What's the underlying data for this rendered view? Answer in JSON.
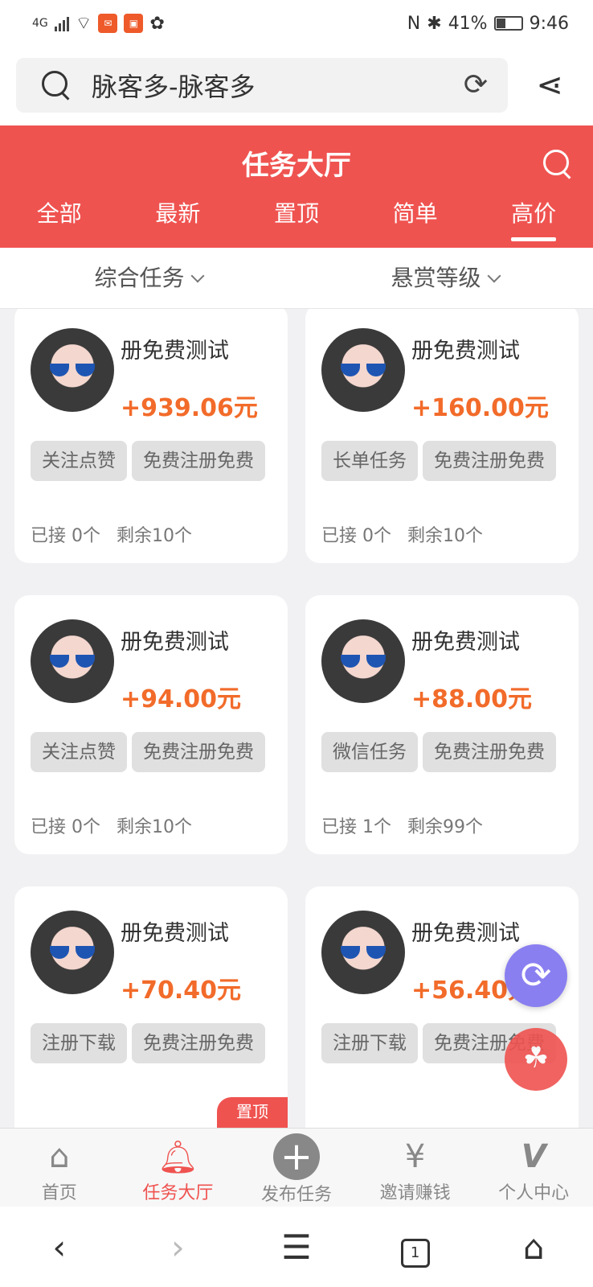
{
  "status_bar": {
    "network": "4G",
    "battery": "41%",
    "battery_level": 0.41,
    "time": "9:46"
  },
  "url_bar": {
    "text": "脉客多-脉客多"
  },
  "header": {
    "title": "任务大厅"
  },
  "tabs": [
    {
      "label": "全部",
      "active": false
    },
    {
      "label": "最新",
      "active": false
    },
    {
      "label": "置顶",
      "active": false
    },
    {
      "label": "简单",
      "active": false
    },
    {
      "label": "高价",
      "active": true
    }
  ],
  "filters": [
    {
      "label": "综合任务"
    },
    {
      "label": "悬赏等级"
    }
  ],
  "cards": [
    {
      "title": "册免费测试",
      "price": "+939.06元",
      "tags": [
        "关注点赞",
        "免费注册免费"
      ],
      "accepted": "已接 0个",
      "remaining": "剩余10个"
    },
    {
      "title": "册免费测试",
      "price": "+160.00元",
      "tags": [
        "长单任务",
        "免费注册免费"
      ],
      "accepted": "已接 0个",
      "remaining": "剩余10个"
    },
    {
      "title": "册免费测试",
      "price": "+94.00元",
      "tags": [
        "关注点赞",
        "免费注册免费"
      ],
      "accepted": "已接 0个",
      "remaining": "剩余10个"
    },
    {
      "title": "册免费测试",
      "price": "+88.00元",
      "tags": [
        "微信任务",
        "免费注册免费"
      ],
      "accepted": "已接 1个",
      "remaining": "剩余99个"
    },
    {
      "title": "册免费测试",
      "price": "+70.40元",
      "tags": [
        "注册下载",
        "免费注册免费"
      ],
      "badge": "置顶"
    },
    {
      "title": "册免费测试",
      "price": "+56.40元",
      "tags": [
        "注册下载",
        "免费注册免费"
      ]
    }
  ],
  "bottom_nav": [
    {
      "label": "首页",
      "icon": "home-icon",
      "active": false
    },
    {
      "label": "任务大厅",
      "icon": "bell-icon",
      "active": true
    },
    {
      "label": "发布任务",
      "icon": "plus-icon",
      "active": false
    },
    {
      "label": "邀请赚钱",
      "icon": "money-bag-icon",
      "active": false
    },
    {
      "label": "个人中心",
      "icon": "vip-icon",
      "active": false
    }
  ],
  "system_nav": {
    "tab_count": "1"
  },
  "colors": {
    "primary": "#ef5350",
    "price": "#f26b2a",
    "fab": "#8a7ff0"
  }
}
